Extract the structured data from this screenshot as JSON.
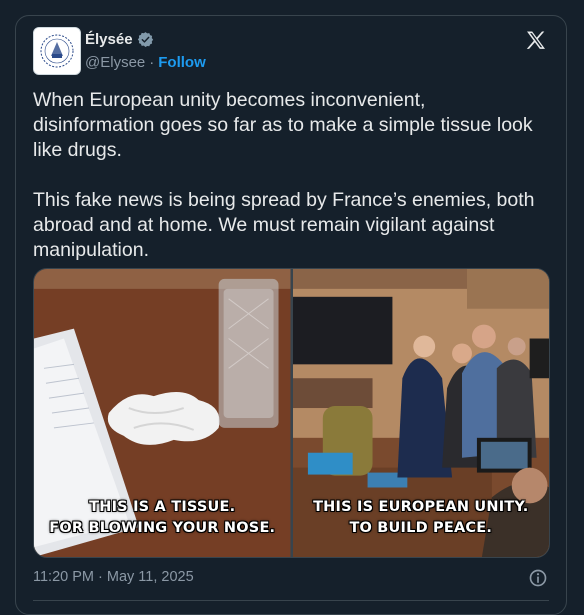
{
  "tweet": {
    "author_name": "Élysée",
    "handle": "@Elysee",
    "separator": "·",
    "follow_label": "Follow",
    "text": "When European unity becomes inconvenient, disinformation goes so far as to make a simple tissue look like drugs.\n\nThis fake news is being spread by France’s enemies, both abroad and at home. We must remain vigilant against manipulation.",
    "timestamp": "11:20 PM · May 11, 2025",
    "media": {
      "left_caption": "THIS IS A TISSUE.\nFOR BLOWING YOUR NOSE.",
      "right_caption": "THIS IS EUROPEAN UNITY.\nTO BUILD PEACE."
    }
  },
  "icons": {
    "verified": "verified-badge-icon",
    "platform": "x-logo-icon",
    "info": "info-icon"
  },
  "colors": {
    "background": "#15202b",
    "accent": "#1d9bf0",
    "muted": "#8b98a5",
    "border": "#38444d"
  }
}
